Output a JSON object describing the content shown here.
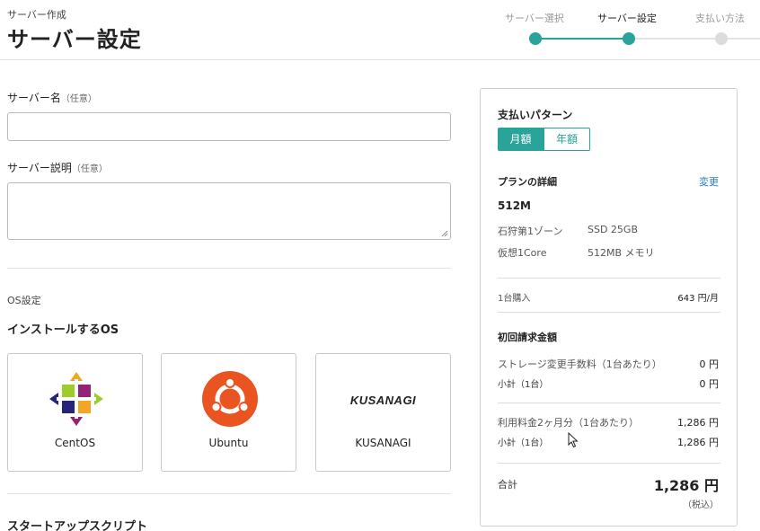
{
  "header": {
    "breadcrumb": "サーバー作成",
    "title": "サーバー設定",
    "steps": [
      {
        "label": "サーバー選択",
        "state": "done"
      },
      {
        "label": "サーバー設定",
        "state": "current"
      },
      {
        "label": "支払い方法",
        "state": "pending"
      }
    ]
  },
  "form": {
    "server_name_label": "サーバー名",
    "server_name_hint": "（任意）",
    "server_name_value": "",
    "server_desc_label": "サーバー説明",
    "server_desc_hint": "（任意）",
    "server_desc_value": "",
    "os_section_label": "OS設定",
    "os_heading": "インストールするOS",
    "os_options": [
      {
        "label": "CentOS",
        "icon": "centos-logo-icon"
      },
      {
        "label": "Ubuntu",
        "icon": "ubuntu-logo-icon"
      },
      {
        "label": "KUSANAGI",
        "icon": "kusanagi-logo-icon",
        "logo_text": "KUSANAGI"
      }
    ],
    "startup_heading": "スタートアップスクリプト"
  },
  "summary": {
    "payment_pattern_label": "支払いパターン",
    "toggle": {
      "monthly": "月額",
      "yearly": "年額",
      "selected": "monthly"
    },
    "plan_details_label": "プランの詳細",
    "change_link": "変更",
    "plan_name": "512M",
    "specs": [
      [
        "石狩第1ゾーン",
        "SSD 25GB"
      ],
      [
        "仮想1Core",
        "512MB メモリ"
      ]
    ],
    "purchase_label": "1台購入",
    "purchase_price": "643 円/月",
    "initial_billing_label": "初回請求金額",
    "storage_fee_label": "ストレージ変更手数料（1台あたり）",
    "storage_fee_value": "0 円",
    "subtotal1_label": "小計（1台）",
    "subtotal1_value": "0 円",
    "usage_fee_label": "利用料金2ヶ月分（1台あたり）",
    "usage_fee_value": "1,286 円",
    "subtotal2_label": "小計（1台）",
    "subtotal2_value": "1,286 円",
    "total_label": "合計",
    "total_value": "1,286 円",
    "tax_note": "（税込）"
  },
  "colors": {
    "accent": "#2aa39a",
    "link": "#2a7bd1",
    "ubuntu": "#e95420"
  }
}
